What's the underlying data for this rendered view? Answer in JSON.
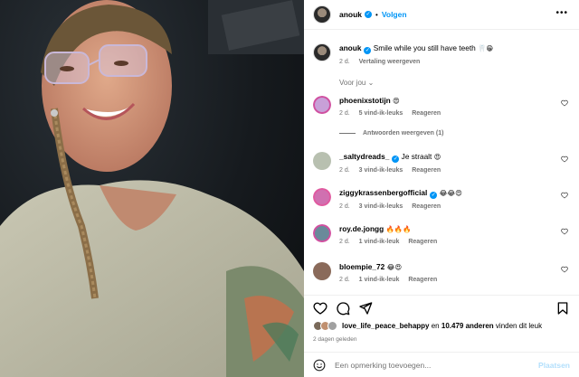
{
  "post": {
    "username": "anouk",
    "follow_label": "Volgen",
    "separator": "•",
    "more_icon": "more-horizontal-icon"
  },
  "caption": {
    "username": "anouk",
    "text": "Smile while you still have teeth",
    "emojis": "🦷😁",
    "time": "2 d.",
    "translate": "Vertaling weergeven"
  },
  "section_label": "Voor jou ⌄",
  "view_replies": "Antwoorden weergeven (1)",
  "comments": [
    {
      "username": "phoenixstotijn",
      "text": "",
      "emojis": "😍",
      "time": "2 d.",
      "likes": "5 vind-ik-leuks",
      "reply": "Reageren",
      "avatar_color": "#c8a0d8"
    },
    {
      "username": "_saltydreads_",
      "text": "Je straalt",
      "emojis": "😍",
      "time": "2 d.",
      "likes": "3 vind-ik-leuks",
      "reply": "Reageren",
      "avatar_color": "#b8c0b0"
    },
    {
      "username": "ziggykrassenbergofficial",
      "text": "",
      "emojis": "😂😂😍",
      "time": "2 d.",
      "likes": "3 vind-ik-leuks",
      "reply": "Reageren",
      "avatar_color": "#d070b0"
    },
    {
      "username": "roy.de.jongg",
      "text": "",
      "emojis": "🔥🔥🔥",
      "time": "2 d.",
      "likes": "1 vind-ik-leuk",
      "reply": "Reageren",
      "avatar_color": "#6a8a9a"
    },
    {
      "username": "bloempie_72",
      "text": "",
      "emojis": "😂😍",
      "time": "2 d.",
      "likes": "1 vind-ik-leuk",
      "reply": "Reageren",
      "avatar_color": "#8a6a5a"
    }
  ],
  "likes": {
    "username": "love_life_peace_behappy",
    "connector": "en",
    "count_text": "10.479 anderen",
    "suffix": "vinden dit leuk"
  },
  "posted_ago": "2 dagen geleden",
  "comment_input": {
    "placeholder": "Een opmerking toevoegen...",
    "post_label": "Plaatsen"
  },
  "colors": {
    "accent": "#0095f6",
    "muted": "#737373",
    "like": "#ed4956"
  }
}
